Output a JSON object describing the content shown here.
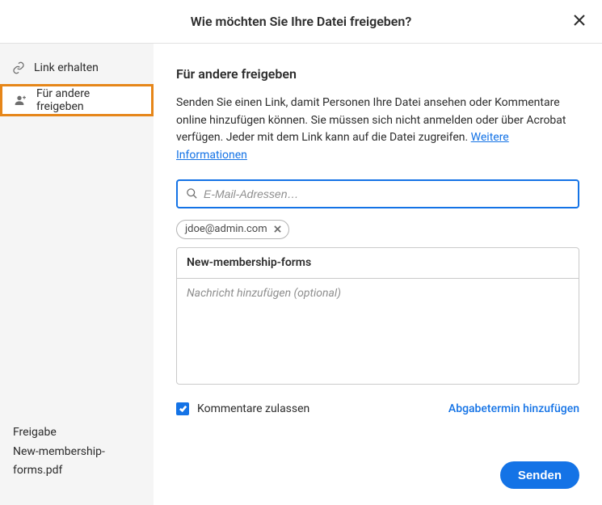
{
  "header": {
    "title": "Wie möchten Sie Ihre Datei freigeben?"
  },
  "sidebar": {
    "items": [
      {
        "label": "Link erhalten"
      },
      {
        "label": "Für andere freigeben"
      }
    ],
    "footer": {
      "label": "Freigabe",
      "filename": "New-membership-forms.pdf"
    }
  },
  "main": {
    "title": "Für andere freigeben",
    "description_pre": "Senden Sie einen Link, damit Personen Ihre Datei ansehen oder Kommentare online hinzufügen können. Sie müssen sich nicht anmelden oder über Acrobat verfügen. Jeder mit dem Link kann auf die Datei zugreifen. ",
    "learn_more": "Weitere Informationen",
    "email_placeholder": "E-Mail-Adressen…",
    "chips": [
      {
        "email": "jdoe@admin.com"
      }
    ],
    "subject": "New-membership-forms",
    "message_placeholder": "Nachricht hinzufügen (optional)",
    "allow_comments_label": "Kommentare zulassen",
    "allow_comments_checked": true,
    "add_due_date": "Abgabetermin hinzufügen",
    "send_label": "Senden"
  }
}
